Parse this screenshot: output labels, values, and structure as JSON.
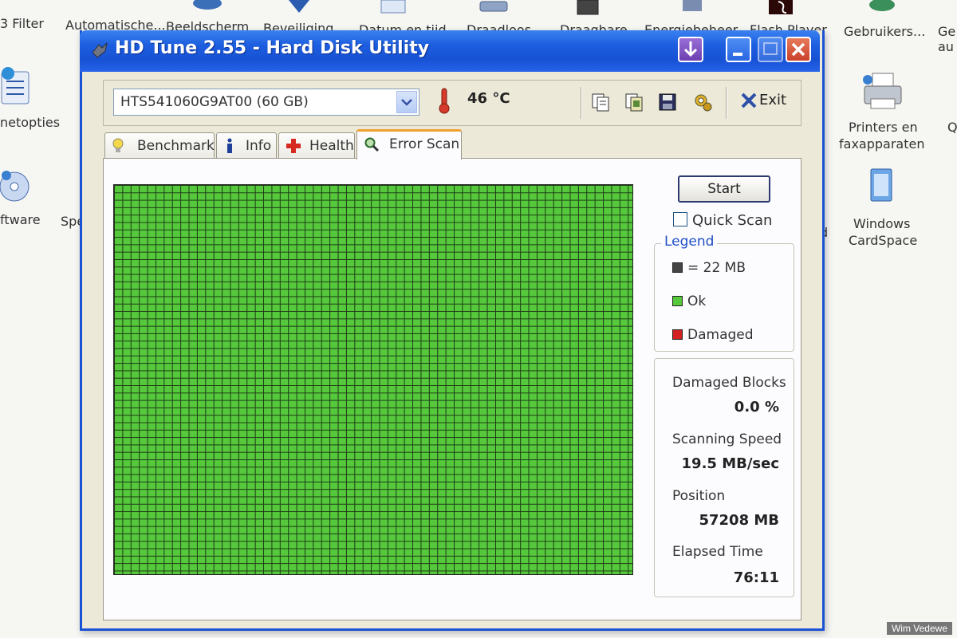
{
  "desktop": {
    "labels": [
      {
        "text": "3 Filter"
      },
      {
        "text": "Automatische..."
      },
      {
        "text": "Beeldscherm"
      },
      {
        "text": "Beveiliging..."
      },
      {
        "text": "Datum en tijd"
      },
      {
        "text": "Draadloos..."
      },
      {
        "text": "Draagbare..."
      },
      {
        "text": "Energiebeheer"
      },
      {
        "text": "Flash Player"
      },
      {
        "text": "Gebruikers..."
      },
      {
        "text": "Ge au"
      },
      {
        "text": "netopties"
      },
      {
        "text": "ftware"
      },
      {
        "text": "Spe"
      },
      {
        "text": "d"
      },
      {
        "text": "Printers en"
      },
      {
        "text": "faxapparaten"
      },
      {
        "text": "Windows"
      },
      {
        "text": "CardSpace"
      },
      {
        "text": "Q"
      }
    ],
    "credit": "Wim Vedewe"
  },
  "window": {
    "title": "HD Tune 2.55 - Hard Disk Utility",
    "drive": "HTS541060G9AT00 (60 GB)",
    "temperature": "46 °C",
    "exit_label": "Exit",
    "tabs": [
      {
        "label": "Benchmark"
      },
      {
        "label": "Info"
      },
      {
        "label": "Health"
      },
      {
        "label": "Error Scan"
      }
    ]
  },
  "scan": {
    "start_label": "Start",
    "quick_scan_label": "Quick Scan",
    "quick_scan_checked": false,
    "legend_title": "Legend",
    "legend": [
      {
        "label": "= 22 MB",
        "color": "#444444"
      },
      {
        "label": "Ok",
        "color": "#55c83c"
      },
      {
        "label": "Damaged",
        "color": "#d42020"
      }
    ],
    "stats": {
      "damaged_blocks_label": "Damaged Blocks",
      "damaged_blocks_value": "0.0 %",
      "scanning_speed_label": "Scanning Speed",
      "scanning_speed_value": "19.5 MB/sec",
      "position_label": "Position",
      "position_value": "57208 MB",
      "elapsed_time_label": "Elapsed Time",
      "elapsed_time_value": "76:11"
    }
  }
}
